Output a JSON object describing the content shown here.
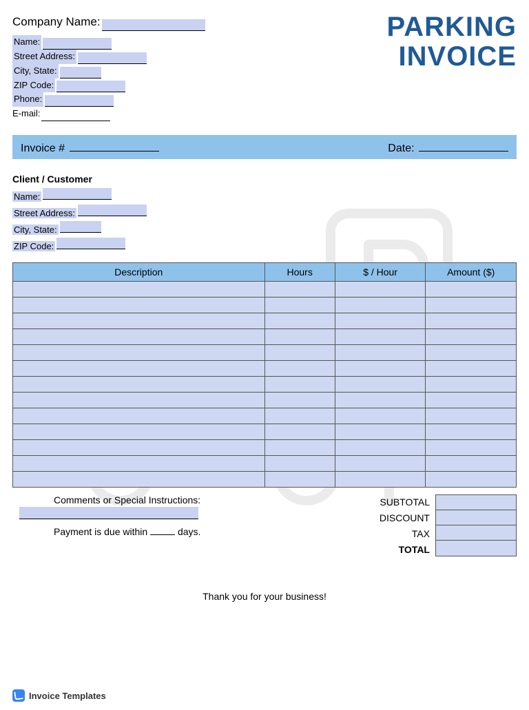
{
  "header": {
    "company_name_label": "Company Name:",
    "name_label": "Name:",
    "street_label": "Street Address:",
    "city_state_label": "City, State:",
    "zip_label": "ZIP Code:",
    "phone_label": "Phone:",
    "email_label": "E-mail:",
    "title_line1": "PARKING",
    "title_line2": "INVOICE"
  },
  "invoice_bar": {
    "number_label": "Invoice #",
    "date_label": "Date:"
  },
  "client": {
    "heading": "Client / Customer",
    "name_label": "Name:",
    "street_label": "Street Address:",
    "city_state_label": "City, State:",
    "zip_label": "ZIP Code:"
  },
  "table": {
    "col_description": "Description",
    "col_hours": "Hours",
    "col_rate": "$ / Hour",
    "col_amount": "Amount ($)",
    "row_count": 13
  },
  "summary": {
    "comments_label": "Comments or Special Instructions:",
    "payment_prefix": "Payment is due within",
    "payment_suffix": "days.",
    "subtotal": "SUBTOTAL",
    "discount": "DISCOUNT",
    "tax": "TAX",
    "total": "TOTAL"
  },
  "thanks": "Thank you for your business!",
  "footer": {
    "brand": "Invoice Templates"
  }
}
